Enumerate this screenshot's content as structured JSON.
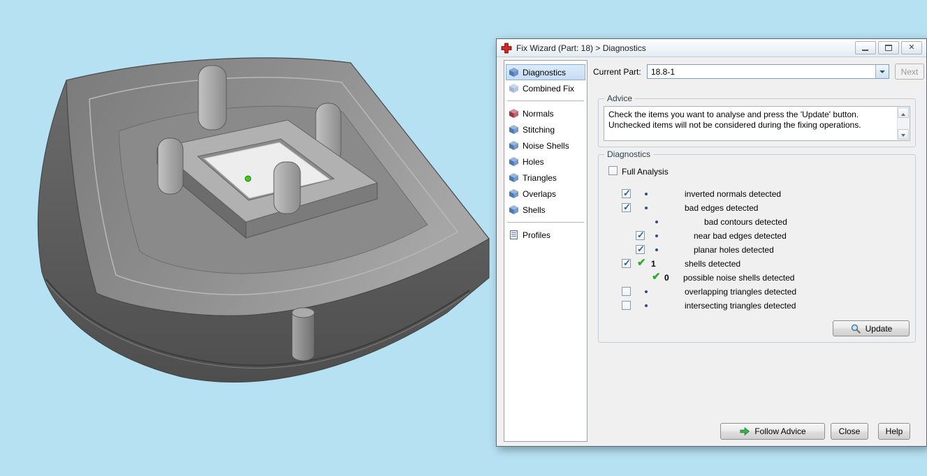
{
  "window": {
    "title": "Fix Wizard (Part: 18) > Diagnostics"
  },
  "viewport": {
    "background_color": "#b6e1f2",
    "model_color": "#8f8f8f",
    "vertex_marker_color": "#3ecb1e"
  },
  "sidebar": {
    "items": [
      {
        "label": "Diagnostics",
        "selected": true,
        "icon": "cube-icon",
        "icon_color": "#4a7ab5"
      },
      {
        "label": "Combined Fix",
        "selected": false,
        "icon": "cube-icon",
        "icon_color": "#9db6d6"
      },
      {
        "label": "Normals",
        "selected": false,
        "icon": "cube-icon",
        "icon_color": "#a23540"
      },
      {
        "label": "Stitching",
        "selected": false,
        "icon": "cube-icon",
        "icon_color": "#4a7ab5"
      },
      {
        "label": "Noise Shells",
        "selected": false,
        "icon": "cube-icon",
        "icon_color": "#4a7ab5"
      },
      {
        "label": "Holes",
        "selected": false,
        "icon": "cube-icon",
        "icon_color": "#4a7ab5"
      },
      {
        "label": "Triangles",
        "selected": false,
        "icon": "cube-icon",
        "icon_color": "#4a7ab5"
      },
      {
        "label": "Overlaps",
        "selected": false,
        "icon": "cube-icon",
        "icon_color": "#4a7ab5"
      },
      {
        "label": "Shells",
        "selected": false,
        "icon": "cube-icon",
        "icon_color": "#4a7ab5"
      },
      {
        "label": "Profiles",
        "selected": false,
        "icon": "document-icon",
        "icon_color": "#4a7ab5"
      }
    ]
  },
  "toolbar": {
    "current_part_label": "Current Part:",
    "current_part_value": "18.8-1",
    "next_label": "Next"
  },
  "advice": {
    "title": "Advice",
    "text": "Check the items you want to analyse and press the 'Update' button. Unchecked items will not be considered during the fixing operations."
  },
  "diagnostics": {
    "title": "Diagnostics",
    "full_analysis_label": "Full Analysis",
    "full_analysis_checked": false,
    "items": [
      {
        "label": "inverted normals detected",
        "checked": true,
        "marker": "bullet",
        "indent": 0
      },
      {
        "label": "bad edges detected",
        "checked": true,
        "marker": "bullet",
        "indent": 0
      },
      {
        "label": "bad contours detected",
        "marker": "bullet",
        "indent": 1
      },
      {
        "label": "near bad edges detected",
        "checked": true,
        "marker": "bullet",
        "indent": 1
      },
      {
        "label": "planar holes detected",
        "checked": true,
        "marker": "bullet",
        "indent": 1
      },
      {
        "label": "shells detected",
        "checked": true,
        "marker": "check",
        "count": "1",
        "indent": 0
      },
      {
        "label": "possible noise shells detected",
        "marker": "check",
        "count": "0",
        "indent": 1
      },
      {
        "label": "overlapping triangles detected",
        "checked": false,
        "marker": "bullet",
        "indent": 0
      },
      {
        "label": "intersecting triangles detected",
        "checked": false,
        "marker": "bullet",
        "indent": 0
      }
    ],
    "update_label": "Update"
  },
  "footer": {
    "follow_advice_label": "Follow Advice",
    "close_label": "Close",
    "help_label": "Help"
  }
}
